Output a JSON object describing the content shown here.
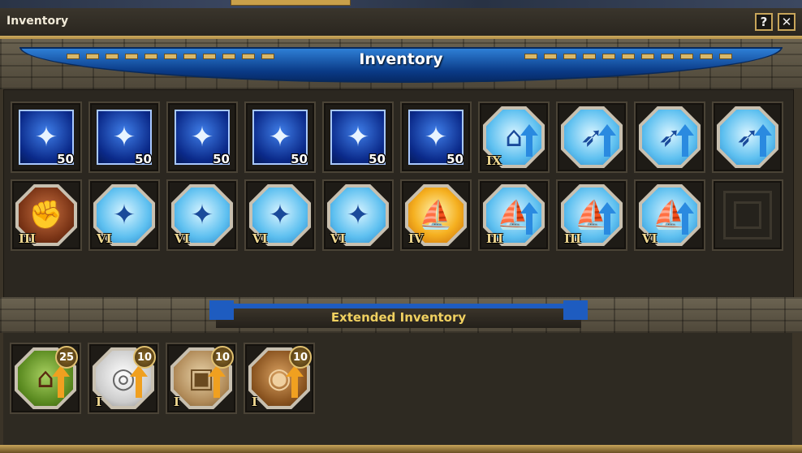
{
  "window": {
    "title": "Inventory",
    "help_label": "?",
    "close_label": "✕"
  },
  "banner": {
    "title": "Inventory"
  },
  "extended": {
    "title": "Extended Inventory"
  },
  "colors": {
    "accent_gold": "#c7a55a",
    "banner_blue": "#0a3a86",
    "extended_title": "#f0d060"
  },
  "inventory_rows": [
    [
      {
        "icon": "sparkle-icon",
        "kind": "square-blue",
        "qty": "50"
      },
      {
        "icon": "sparkle-icon",
        "kind": "square-blue",
        "qty": "50"
      },
      {
        "icon": "sparkle-icon",
        "kind": "square-blue",
        "qty": "50"
      },
      {
        "icon": "sparkle-icon",
        "kind": "square-blue",
        "qty": "50"
      },
      {
        "icon": "sparkle-icon",
        "kind": "square-blue",
        "qty": "50"
      },
      {
        "icon": "sparkle-icon",
        "kind": "square-blue",
        "qty": "50"
      },
      {
        "icon": "building-upgrade-icon",
        "kind": "oct-light",
        "level": "IX"
      },
      {
        "icon": "ballista-upgrade-icon",
        "kind": "oct-light"
      },
      {
        "icon": "ballista-upgrade-icon",
        "kind": "oct-light"
      },
      {
        "icon": "ballista-upgrade-icon",
        "kind": "oct-light"
      }
    ],
    [
      {
        "icon": "gauntlet-icon",
        "kind": "oct-brown",
        "level": "III"
      },
      {
        "icon": "sparkle-icon",
        "kind": "oct-light",
        "level": "VI"
      },
      {
        "icon": "sparkle-icon",
        "kind": "oct-light",
        "level": "VI"
      },
      {
        "icon": "sparkle-icon",
        "kind": "oct-light",
        "level": "VI"
      },
      {
        "icon": "sparkle-icon",
        "kind": "oct-light",
        "level": "VI"
      },
      {
        "icon": "ship-helmet-icon",
        "kind": "oct-orange",
        "level": "IV"
      },
      {
        "icon": "ship-helmet-upgrade-icon",
        "kind": "oct-light",
        "level": "III"
      },
      {
        "icon": "ship-helmet-upgrade-icon",
        "kind": "oct-light",
        "level": "III"
      },
      {
        "icon": "ship-helmet-upgrade-icon",
        "kind": "oct-light",
        "level": "VI"
      },
      {
        "icon": "empty-slot-icon",
        "kind": "empty"
      }
    ]
  ],
  "extended_items": [
    {
      "icon": "house-upgrade-icon",
      "kind": "oct-green",
      "badge": "25"
    },
    {
      "icon": "silver-upgrade-icon",
      "kind": "oct-white",
      "badge": "10",
      "level": "I"
    },
    {
      "icon": "stone-upgrade-icon",
      "kind": "oct-stone",
      "badge": "10",
      "level": "I"
    },
    {
      "icon": "wood-upgrade-icon",
      "kind": "oct-wood",
      "badge": "10",
      "level": "I"
    }
  ]
}
